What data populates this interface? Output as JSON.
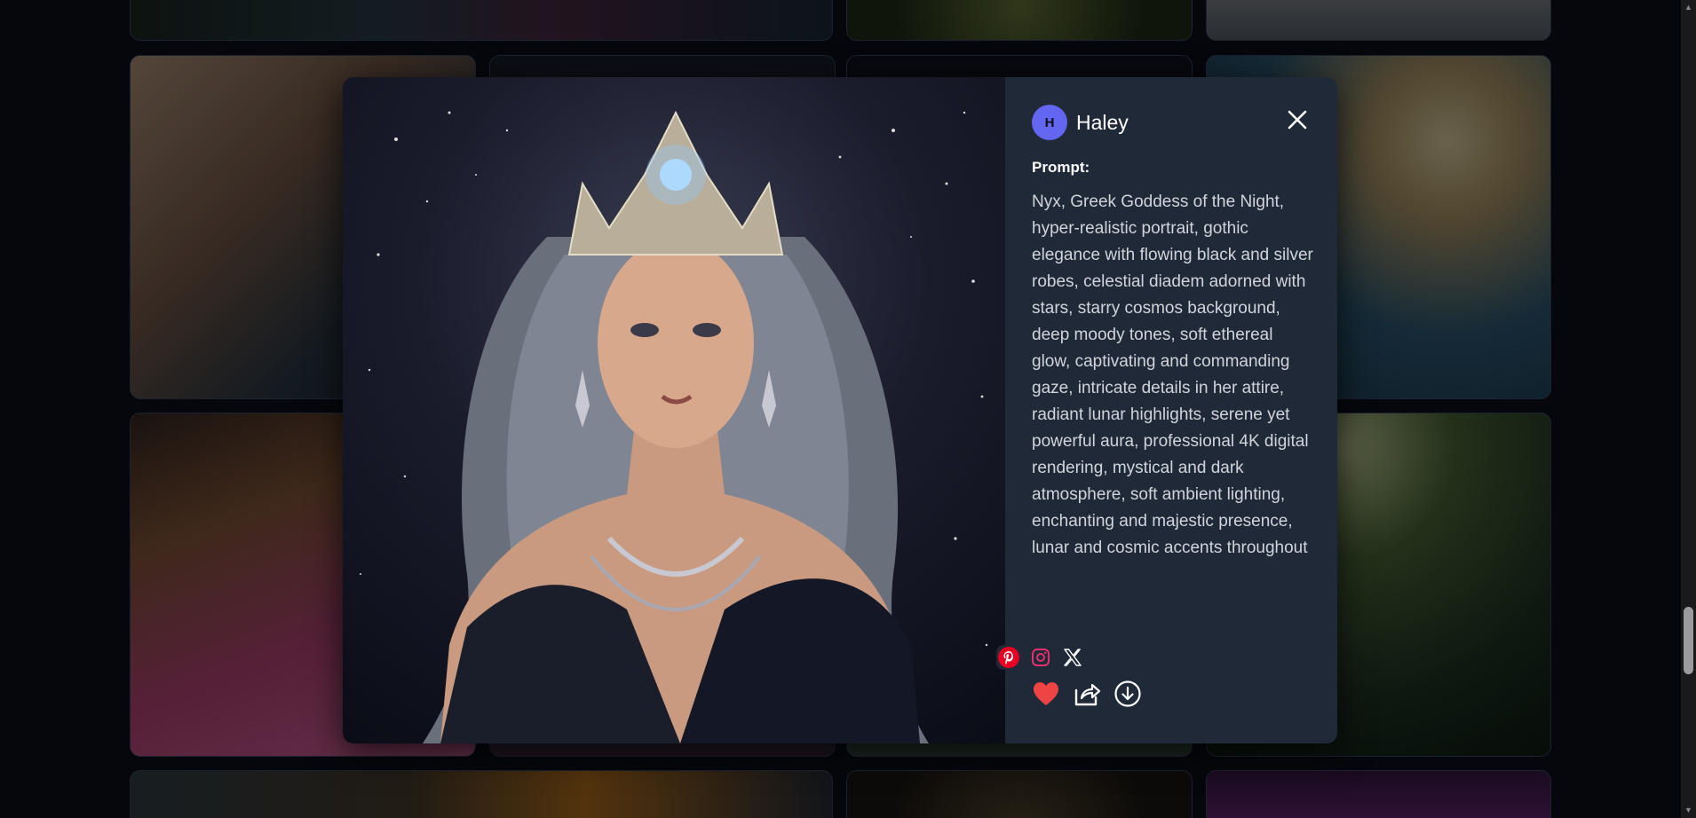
{
  "modal": {
    "user": {
      "avatar_letter": "H",
      "name": "Haley"
    },
    "prompt_label": "Prompt:",
    "prompt_text": "Nyx, Greek Goddess of the Night, hyper-realistic portrait, gothic elegance with flowing black and silver robes, celestial diadem adorned with stars, starry cosmos background, deep moody tones, soft ethereal glow, captivating and commanding gaze, intricate details in her attire, radiant lunar highlights, serene yet powerful aura, professional 4K digital rendering, mystical and dark atmosphere, soft ambient lighting, enchanting and majestic presence, lunar and cosmic accents throughout",
    "share_icons": [
      "pinterest-icon",
      "instagram-icon",
      "x-icon"
    ],
    "action_icons": [
      "heart-icon",
      "share-icon",
      "download-icon"
    ],
    "colors": {
      "panel_bg": "#1f2937",
      "avatar_bg": "#6366f1",
      "heart": "#ef4444",
      "pinterest": "#e60023",
      "instagram": "#e1306c"
    }
  }
}
